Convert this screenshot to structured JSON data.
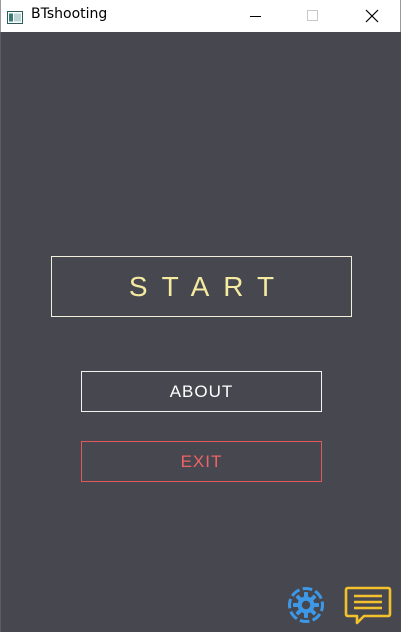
{
  "window": {
    "title": "BTshooting",
    "icons": {
      "app": "app-window-icon",
      "minimize": "minimize-icon",
      "maximize": "maximize-icon",
      "close": "close-icon"
    }
  },
  "menu": {
    "start_label": "START",
    "about_label": "ABOUT",
    "exit_label": "EXIT"
  },
  "corner_icons": {
    "settings": "gear-icon",
    "feedback": "chat-message-icon"
  },
  "colors": {
    "background": "#474750",
    "start_text": "#f4eaa0",
    "start_border": "#f2f0dc",
    "about_text": "#ffffff",
    "exit_text": "#ef6466",
    "exit_border": "#e0585c",
    "settings_icon": "#3d98e8",
    "feedback_icon": "#f3c12c"
  }
}
